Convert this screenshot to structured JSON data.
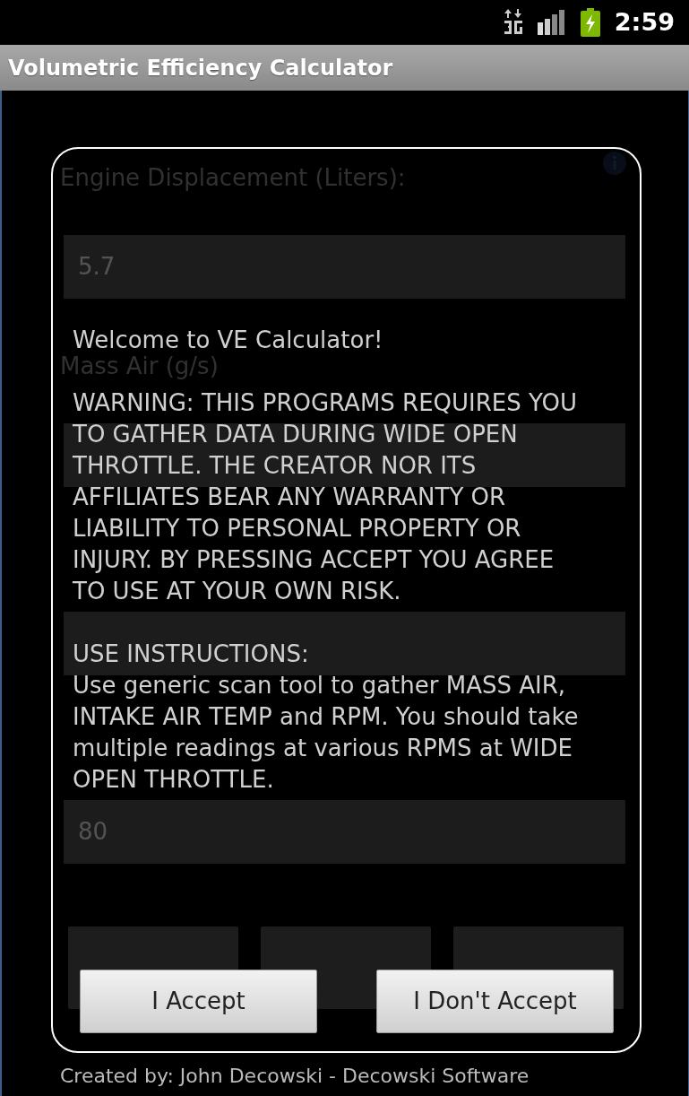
{
  "status_bar": {
    "time": "2:59"
  },
  "title_bar": {
    "title": "Volumetric Efficiency Calculator"
  },
  "form": {
    "fields": [
      {
        "kind": "field",
        "label": "Engine Displacement (Liters):",
        "value": "5.7"
      },
      {
        "kind": "field",
        "label": "Mass Air (g/s)"
      },
      {
        "kind": "field"
      },
      {
        "kind": "field",
        "value": "80"
      }
    ],
    "buttons": [
      {
        "kind": "blank"
      },
      {
        "kind": "blank"
      },
      {
        "kind": "blank"
      }
    ],
    "footer": "Created by: John Decowski - Decowski Software"
  },
  "dialog": {
    "paragraphs": [
      {
        "kind": "text",
        "text": "Welcome to VE Calculator!"
      },
      {
        "kind": "text",
        "text": "WARNING: THIS PROGRAMS REQUIRES YOU TO GATHER DATA DURING WIDE OPEN THROTTLE. THE CREATOR NOR ITS AFFILIATES BEAR ANY WARRANTY OR LIABILITY TO PERSONAL PROPERTY OR INJURY. BY PRESSING ACCEPT YOU AGREE TO USE AT YOUR OWN RISK."
      },
      {
        "kind": "heading",
        "text": "USE INSTRUCTIONS:"
      },
      {
        "kind": "text",
        "text": "Use generic scan tool to gather MASS AIR, INTAKE AIR TEMP and RPM. You should take multiple readings at various RPMS at WIDE OPEN THROTTLE."
      }
    ],
    "buttons": [
      "I Accept",
      "I Don't Accept"
    ]
  }
}
